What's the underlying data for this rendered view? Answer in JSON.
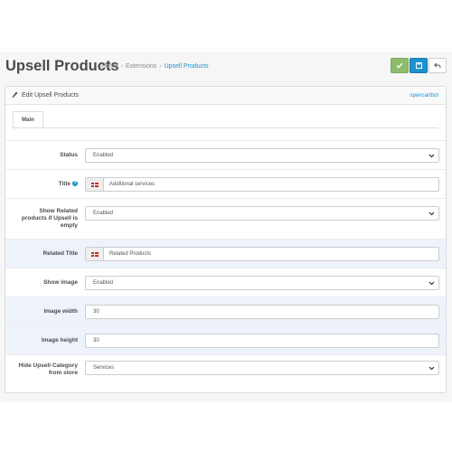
{
  "header": {
    "title": "Upsell Products",
    "breadcrumb": [
      "Home",
      "Extensions",
      "Upsell Products"
    ],
    "breadcrumb_sep": "›"
  },
  "toolbar": {
    "save_icon": "check-icon",
    "apply_icon": "save-icon",
    "back_icon": "reply-icon",
    "save_color": "#8fbb6c",
    "apply_color": "#1e91cf"
  },
  "panel": {
    "title": "Edit Upsell Products",
    "brand_link": "opencartbot",
    "tab": "Main"
  },
  "form": {
    "status": {
      "label": "Status",
      "value": "Enabled"
    },
    "title": {
      "label": "Title",
      "value": "Additional services"
    },
    "show_related": {
      "label": "Show Related products if Upsell is empty",
      "value": "Enabled"
    },
    "related_title": {
      "label": "Related Title",
      "value": "Related Products"
    },
    "show_image": {
      "label": "Show image",
      "value": "Enabled"
    },
    "image_width": {
      "label": "Image width",
      "value": "30"
    },
    "image_height": {
      "label": "Image height",
      "value": "30"
    },
    "hide_category": {
      "label": "Hide Upsell Category from store",
      "value": "Services"
    }
  },
  "colors": {
    "accent": "#1e91cf",
    "highlight_row": "#eef3fb"
  }
}
